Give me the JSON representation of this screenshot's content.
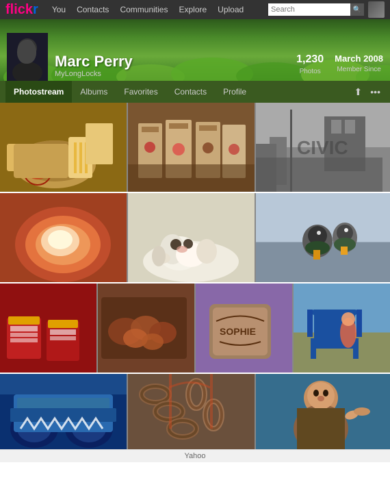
{
  "topnav": {
    "logo": {
      "pink": "flickr",
      "blue": ""
    },
    "links": [
      "You",
      "Contacts",
      "Communities",
      "Explore",
      "Upload"
    ],
    "search_placeholder": "Search"
  },
  "hero": {
    "profile_name": "Marc Perry",
    "profile_username": "MyLongLocks",
    "stats": {
      "photos_count": "1,230",
      "photos_label": "Photos",
      "member_since_label": "Member Since",
      "member_since_date": "March 2008"
    }
  },
  "subnav": {
    "items": [
      "Photostream",
      "Albums",
      "Favorites",
      "Contacts",
      "Profile"
    ],
    "active": "Photostream"
  },
  "photos": {
    "rows": [
      {
        "cells": [
          {
            "color": "food",
            "label": "sandwich fries"
          },
          {
            "color": "bags",
            "label": "coffee bags"
          },
          {
            "color": "street",
            "label": "street scene"
          }
        ]
      },
      {
        "cells": [
          {
            "color": "bowl",
            "label": "food bowl"
          },
          {
            "color": "puppy",
            "label": "sleeping puppy"
          },
          {
            "color": "duck",
            "label": "duck by water"
          }
        ]
      },
      {
        "cells": [
          {
            "color": "jars",
            "label": "jam jars"
          },
          {
            "color": "food2",
            "label": "roasted food"
          },
          {
            "color": "cookie",
            "label": "sophie cookie"
          },
          {
            "color": "chair",
            "label": "blue chair outdoor"
          }
        ]
      },
      {
        "cells": [
          {
            "color": "monster",
            "label": "monster truck"
          },
          {
            "color": "chains",
            "label": "bridge chains"
          },
          {
            "color": "portrait",
            "label": "man portrait"
          }
        ]
      }
    ]
  },
  "footer": {
    "text": "Yahoo"
  }
}
